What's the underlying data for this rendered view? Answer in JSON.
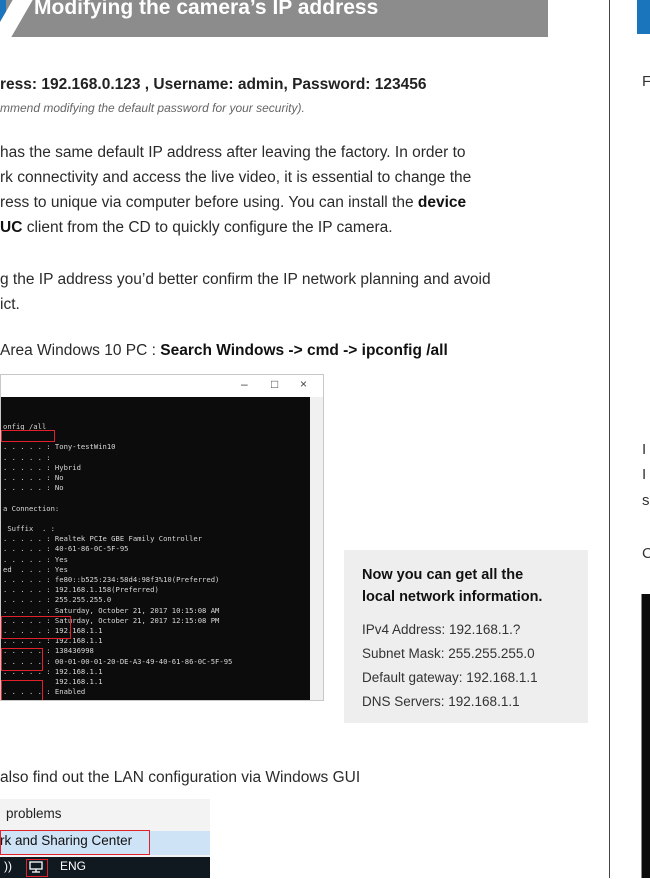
{
  "header": {
    "title": "Modifying the camera’s IP address"
  },
  "defaults": {
    "line": "ress: 192.168.0.123 , Username: admin, Password: 123456",
    "recommend": "mmend modifying the default password for your security)."
  },
  "body": {
    "p1_l1": " has the same default IP address after leaving the factory. In order to",
    "p1_l2": "rk connectivity and access the live video, it is essential to change the",
    "p1_l3a": "ress to unique via computer before using. You can install the ",
    "p1_l3b": "device",
    "p1_l4a": "UC",
    "p1_l4b": " client from the CD to quickly configure the IP camera.",
    "p2_l1": "g the IP address you’d better confirm the IP network planning and avoid",
    "p2_l2": "ict.",
    "p3_a": "Area Windows 10 PC : ",
    "p3_b": "Search Windows -> cmd -> ipconfig /all",
    "p4": " also find out the LAN configuration via Windows GUI"
  },
  "cmd_window": {
    "buttons": {
      "min": "–",
      "max": "□",
      "close": "×"
    },
    "lines": [
      "onfig /all",
      "",
      ". . . . . : Tony-testWin10",
      ". . . . . :",
      ". . . . . : Hybrid",
      ". . . . . : No",
      ". . . . . : No",
      "",
      "a Connection:",
      "",
      " Suffix  . :",
      ". . . . . : Realtek PCIe GBE Family Controller",
      ". . . . . : 40-61-86-0C-5F-95",
      ". . . . . : Yes",
      "ed  . . . : Yes",
      ". . . . . : fe80::b525:234:58d4:98f3%10(Preferred)",
      ". . . . . : 192.168.1.158(Preferred)",
      ". . . . . : 255.255.255.0",
      ". . . . . : Saturday, October 21, 2017 10:15:08 AM",
      ". . . . . : Saturday, October 21, 2017 12:15:08 PM",
      ". . . . . : 192.168.1.1",
      ". . . . . : 192.168.1.1",
      ". . . . . : 138436998",
      ". . . . . : 00-01-00-01-20-DE-A3-49-40-61-86-0C-5F-95",
      ". . . . . : 192.168.1.1",
      "            192.168.1.1",
      ". . . . . : Enabled"
    ]
  },
  "info_box": {
    "heading_l1": "Now you can get all the",
    "heading_l2": "local network information.",
    "ipv4": "IPv4 Address: 192.168.1.?",
    "subnet": "Subnet Mask: 255.255.255.0",
    "gateway": "Default gateway: 192.168.1.1",
    "dns": "DNS Servers: 192.168.1.1"
  },
  "gui_menu": {
    "item1": "problems",
    "item2": "rk and Sharing Center",
    "taskbar_lang": "ENG",
    "taskbar_sound": "))"
  },
  "right_column": {
    "letters": [
      "F",
      "I",
      "I",
      "s",
      "C"
    ]
  },
  "colors": {
    "accent_blue": "#1b75bc",
    "banner_gray": "#8c8c8c",
    "highlight_red": "#e0202a"
  }
}
